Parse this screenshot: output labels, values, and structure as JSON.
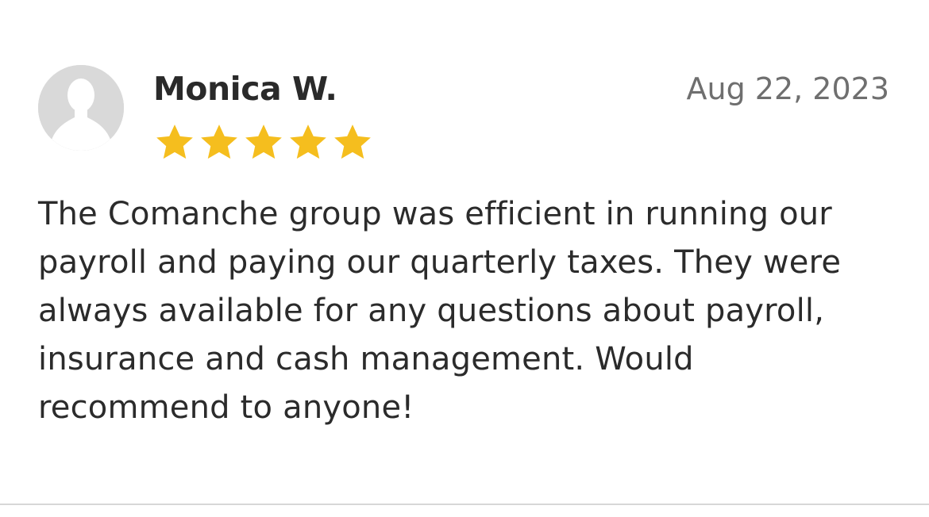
{
  "review": {
    "reviewer_name": "Monica W.",
    "date": "Aug 22, 2023",
    "rating": 5,
    "rating_max": 5,
    "star_color": "#F5BE1E",
    "text": "The Comanche group was efficient in running our payroll and paying our quarterly taxes. They were always available for any questions about payroll, insurance and cash management. Would recommend to anyone!",
    "avatar_icon": "default-user-avatar-icon",
    "star_icon": "star-icon"
  }
}
